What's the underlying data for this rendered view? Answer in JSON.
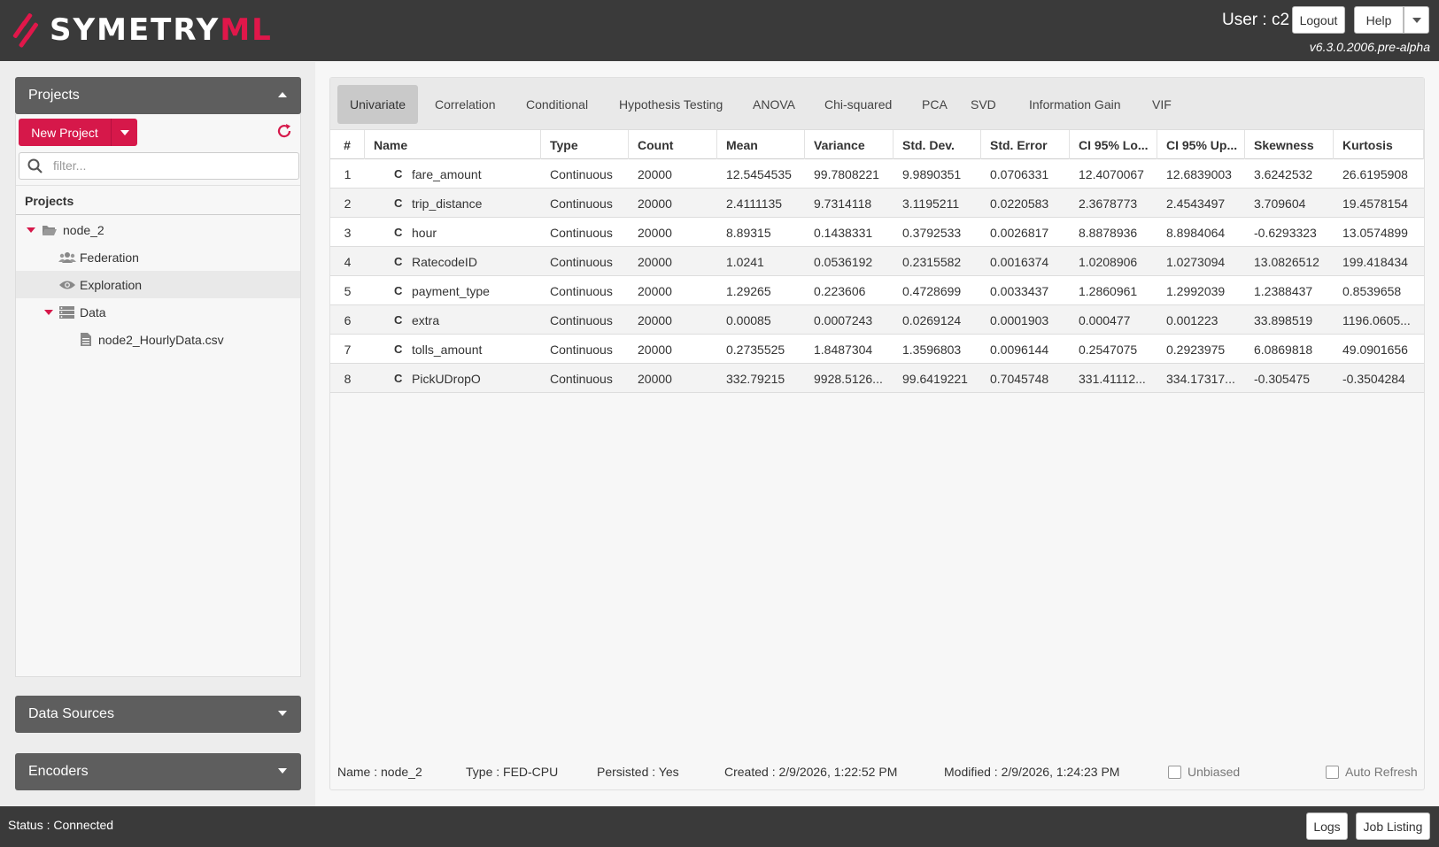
{
  "header": {
    "logo_primary": "SYMETRY",
    "logo_accent": "ML",
    "user": "User : c2",
    "logout_label": "Logout",
    "help_label": "Help",
    "version": "v6.3.0.2006.pre-alpha"
  },
  "sidebar": {
    "projects_title": "Projects",
    "new_project_label": "New Project",
    "filter_placeholder": "filter...",
    "projects_label": "Projects",
    "tree": {
      "node": "node_2",
      "federation": "Federation",
      "exploration": "Exploration",
      "data": "Data",
      "file": "node2_HourlyData.csv"
    },
    "data_sources_title": "Data Sources",
    "encoders_title": "Encoders"
  },
  "tabs": [
    "Univariate",
    "Correlation",
    "Conditional",
    "Hypothesis Testing",
    "ANOVA",
    "Chi-squared",
    "PCA",
    "SVD",
    "Information Gain",
    "VIF"
  ],
  "table": {
    "columns": [
      "#",
      "Name",
      "Type",
      "Count",
      "Mean",
      "Variance",
      "Std. Dev.",
      "Std. Error",
      "CI 95% Lo...",
      "CI 95% Up...",
      "Skewness",
      "Kurtosis"
    ],
    "type_badge": "C",
    "rows": [
      [
        "1",
        "fare_amount",
        "Continuous",
        "20000",
        "12.5454535",
        "99.7808221",
        "9.9890351",
        "0.0706331",
        "12.4070067",
        "12.6839003",
        "3.6242532",
        "26.6195908"
      ],
      [
        "2",
        "trip_distance",
        "Continuous",
        "20000",
        "2.4111135",
        "9.7314118",
        "3.1195211",
        "0.0220583",
        "2.3678773",
        "2.4543497",
        "3.709604",
        "19.4578154"
      ],
      [
        "3",
        "hour",
        "Continuous",
        "20000",
        "8.89315",
        "0.1438331",
        "0.3792533",
        "0.0026817",
        "8.8878936",
        "8.8984064",
        "-0.6293323",
        "13.0574899"
      ],
      [
        "4",
        "RatecodeID",
        "Continuous",
        "20000",
        "1.0241",
        "0.0536192",
        "0.2315582",
        "0.0016374",
        "1.0208906",
        "1.0273094",
        "13.0826512",
        "199.418434"
      ],
      [
        "5",
        "payment_type",
        "Continuous",
        "20000",
        "1.29265",
        "0.223606",
        "0.4728699",
        "0.0033437",
        "1.2860961",
        "1.2992039",
        "1.2388437",
        "0.8539658"
      ],
      [
        "6",
        "extra",
        "Continuous",
        "20000",
        "0.00085",
        "0.0007243",
        "0.0269124",
        "0.0001903",
        "0.000477",
        "0.001223",
        "33.898519",
        "1196.0605..."
      ],
      [
        "7",
        "tolls_amount",
        "Continuous",
        "20000",
        "0.2735525",
        "1.8487304",
        "1.3596803",
        "0.0096144",
        "0.2547075",
        "0.2923975",
        "6.0869818",
        "49.0901656"
      ],
      [
        "8",
        "PickUDropO",
        "Continuous",
        "20000",
        "332.79215",
        "9928.5126...",
        "99.6419221",
        "0.7045748",
        "331.41112...",
        "334.17317...",
        "-0.305475",
        "-0.3504284"
      ]
    ]
  },
  "info": {
    "name": "Name : node_2",
    "type": "Type : FED-CPU",
    "persisted": "Persisted : Yes",
    "created": "Created : 2/9/2026, 1:22:52 PM",
    "modified": "Modified : 2/9/2026, 1:24:23 PM",
    "unbiased_label": "Unbiased",
    "auto_refresh_label": "Auto Refresh"
  },
  "status": {
    "text": "Status : Connected",
    "logs_label": "Logs",
    "job_listing_label": "Job Listing"
  },
  "colors": {
    "brand": "#d6184a",
    "header_bg": "#3a3a3a",
    "panel_head": "#5e5e5e"
  },
  "icons": [
    "logo-icon",
    "refresh-icon",
    "search-icon",
    "folder-open-icon",
    "users-icon",
    "eye-icon",
    "database-icon",
    "file-icon",
    "chevron-up-icon",
    "chevron-down-icon"
  ]
}
